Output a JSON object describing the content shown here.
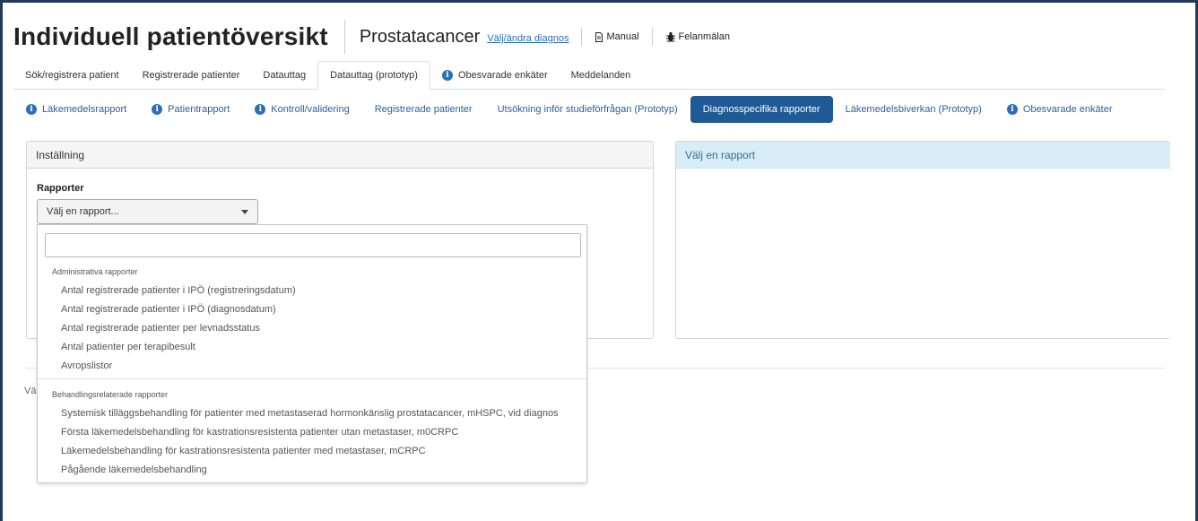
{
  "header": {
    "app_title": "Individuell patientöversikt",
    "diagnosis": "Prostatacancer",
    "change_diagnosis": "Välj/ändra diagnos",
    "manual": "Manual",
    "report_error": "Felanmälan"
  },
  "tabs": [
    {
      "label": "Sök/registrera patient",
      "info": false,
      "active": false
    },
    {
      "label": "Registrerade patienter",
      "info": false,
      "active": false
    },
    {
      "label": "Datauttag",
      "info": false,
      "active": false
    },
    {
      "label": "Datauttag (prototyp)",
      "info": false,
      "active": true
    },
    {
      "label": "Obesvarade enkäter",
      "info": true,
      "active": false
    },
    {
      "label": "Meddelanden",
      "info": false,
      "active": false
    }
  ],
  "subnav": [
    {
      "label": "Läkemedelsrapport",
      "info": true,
      "active": false
    },
    {
      "label": "Patientrapport",
      "info": true,
      "active": false
    },
    {
      "label": "Kontroll/validering",
      "info": true,
      "active": false
    },
    {
      "label": "Registrerade patienter",
      "info": false,
      "active": false
    },
    {
      "label": "Utsökning inför studieförfrågan (Prototyp)",
      "info": false,
      "active": false
    },
    {
      "label": "Diagnosspecifika rapporter",
      "info": false,
      "active": true
    },
    {
      "label": "Läkemedelsbiverkan (Prototyp)",
      "info": false,
      "active": false
    },
    {
      "label": "Obesvarade enkäter",
      "info": true,
      "active": false
    }
  ],
  "settings_panel": {
    "title": "Inställning",
    "reports_label": "Rapporter",
    "select_value": "Välj en rapport..."
  },
  "report_panel": {
    "title": "Välj en rapport"
  },
  "below_label": "Väl",
  "dropdown": {
    "search_value": "",
    "groups": [
      {
        "label": "Administrativa rapporter",
        "options": [
          "Antal registrerade patienter i IPÖ (registreringsdatum)",
          "Antal registrerade patienter i IPÖ (diagnosdatum)",
          "Antal registrerade patienter per levnadsstatus",
          "Antal patienter per terapibesult",
          "Avropslistor"
        ]
      },
      {
        "label": "Behandlingsrelaterade rapporter",
        "options": [
          "Systemisk tilläggsbehandling för patienter med metastaserad hormonkänslig prostatacancer, mHSPC, vid diagnos",
          "Första läkemedelsbehandling för kastrationsresistenta patienter utan metastaser, m0CRPC",
          "Läkemedelsbehandling för kastrationsresistenta patienter med metastaser, mCRPC",
          "Pågående läkemedelsbehandling"
        ]
      }
    ]
  },
  "colors": {
    "frame_border": "#1f3a5c",
    "link": "#2a6ebb",
    "active_pill": "#1f5a96",
    "info_panel_head": "#d9edf7"
  }
}
